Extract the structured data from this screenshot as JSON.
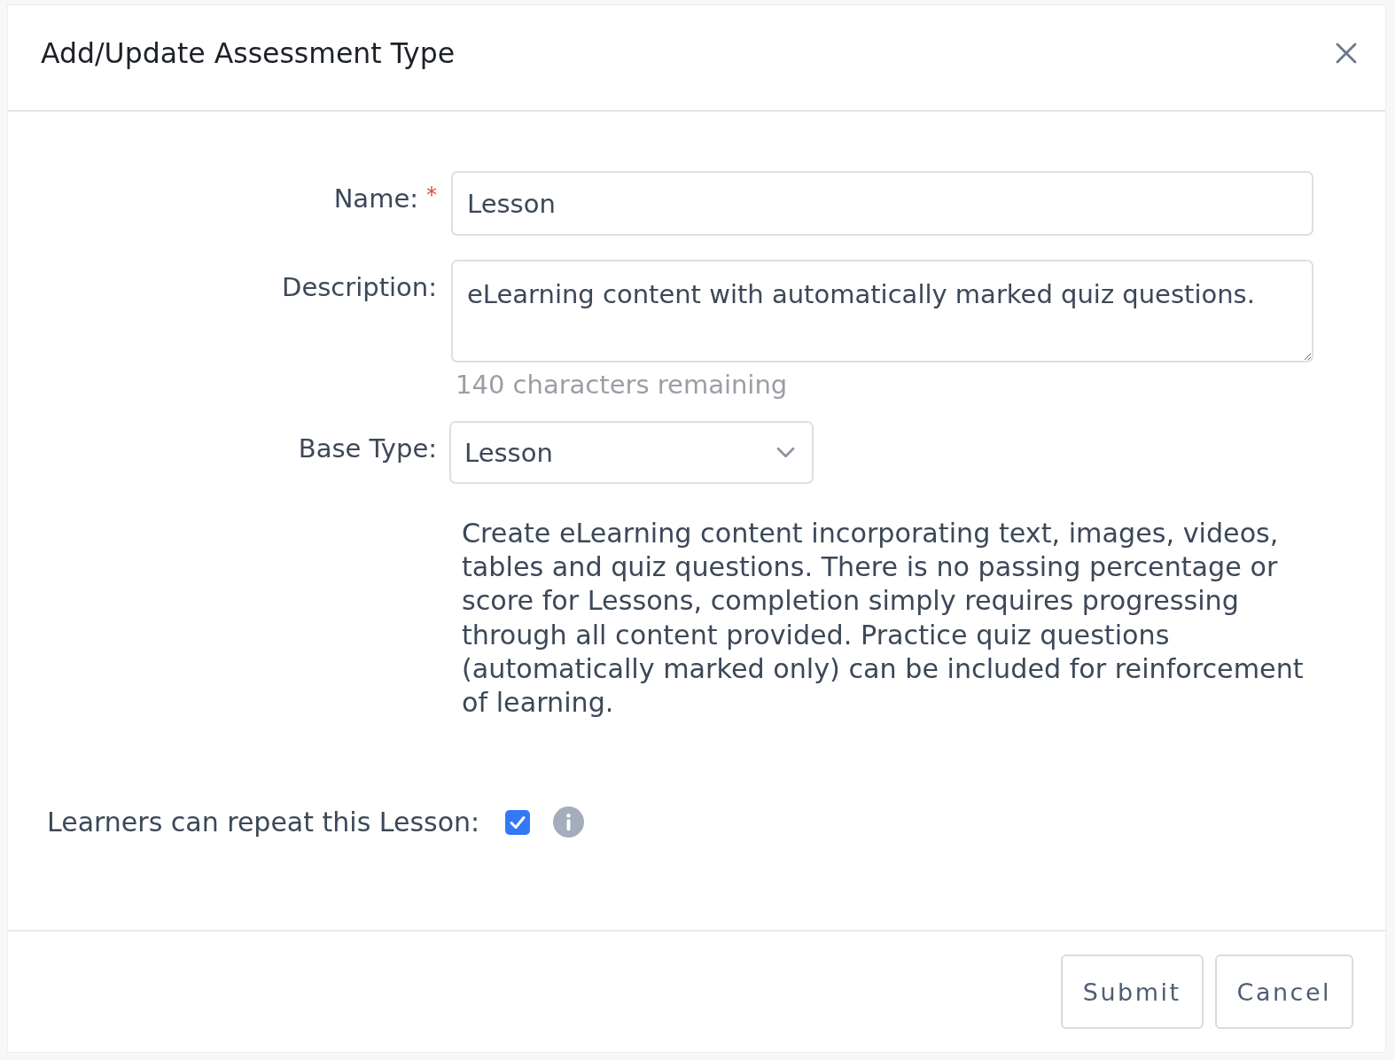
{
  "dialog": {
    "title": "Add/Update Assessment Type"
  },
  "form": {
    "fields": [
      {
        "kind": "text",
        "label": "Name:",
        "required_mark": "*",
        "value": "Lesson"
      },
      {
        "kind": "textarea",
        "label": "Description:",
        "value": "eLearning content with automatically marked quiz questions.",
        "helper": "140 characters remaining"
      },
      {
        "kind": "select",
        "label": "Base Type:",
        "value": "Lesson",
        "hint": "Create eLearning content incorporating text, images, videos, tables and quiz questions. There is no passing percentage or score for Lessons, completion simply requires progressing through all content provided. Practice quiz questions (automatically marked only) can be included for reinforcement of learning."
      }
    ],
    "repeat_option": {
      "label": "Learners can repeat this Lesson:",
      "checked": true
    }
  },
  "buttons": [
    {
      "label": "Submit"
    },
    {
      "label": "Cancel"
    }
  ]
}
